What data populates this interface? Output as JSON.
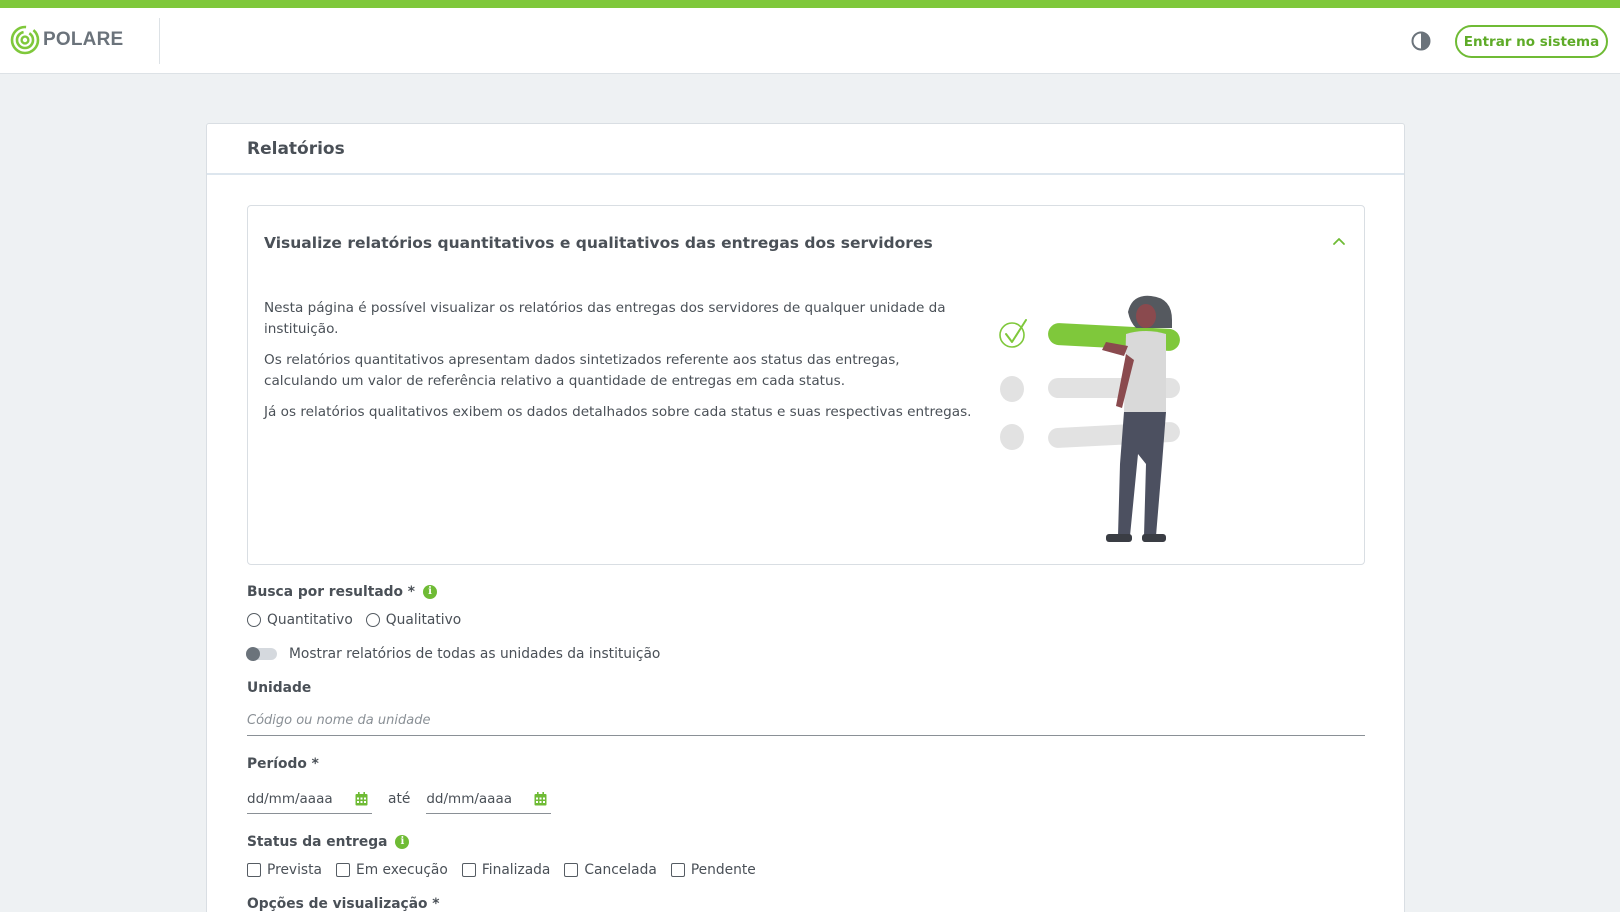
{
  "colors": {
    "accent": "#7fc83b",
    "brand_green": "#6fbb35",
    "text": "#4a5057",
    "background": "#eef1f3"
  },
  "header": {
    "logo_text": "POLARE",
    "contrast_icon": "contrast-icon",
    "login_label": "Entrar no sistema"
  },
  "card": {
    "title": "Relatórios"
  },
  "info_panel": {
    "title": "Visualize relatórios quantitativos e qualitativos das entregas dos servidores",
    "collapse_icon": "chevron-up-icon",
    "paragraphs": [
      "Nesta página é possível visualizar os relatórios das entregas dos servidores de qualquer unidade da instituição.",
      "Os relatórios quantitativos apresentam dados sintetizados referente aos status das entregas, calculando um valor de referência relativo a quantidade de entregas em cada status.",
      "Já os relatórios qualitativos exibem os dados detalhados sobre cada status e suas respectivas entregas."
    ]
  },
  "form": {
    "busca_label": "Busca por resultado *",
    "busca_options": [
      "Quantitativo",
      "Qualitativo"
    ],
    "toggle_label": "Mostrar relatórios de todas as unidades da instituição",
    "unidade_label": "Unidade",
    "unidade_placeholder": "Código ou nome da unidade",
    "periodo_label": "Período *",
    "date_placeholder_start": "dd/mm/aaaa",
    "date_placeholder_end": "dd/mm/aaaa",
    "ate": "até",
    "status_label": "Status da entrega",
    "status_options": [
      "Prevista",
      "Em execução",
      "Finalizada",
      "Cancelada",
      "Pendente"
    ],
    "opcoes_label": "Opções de visualização *"
  }
}
